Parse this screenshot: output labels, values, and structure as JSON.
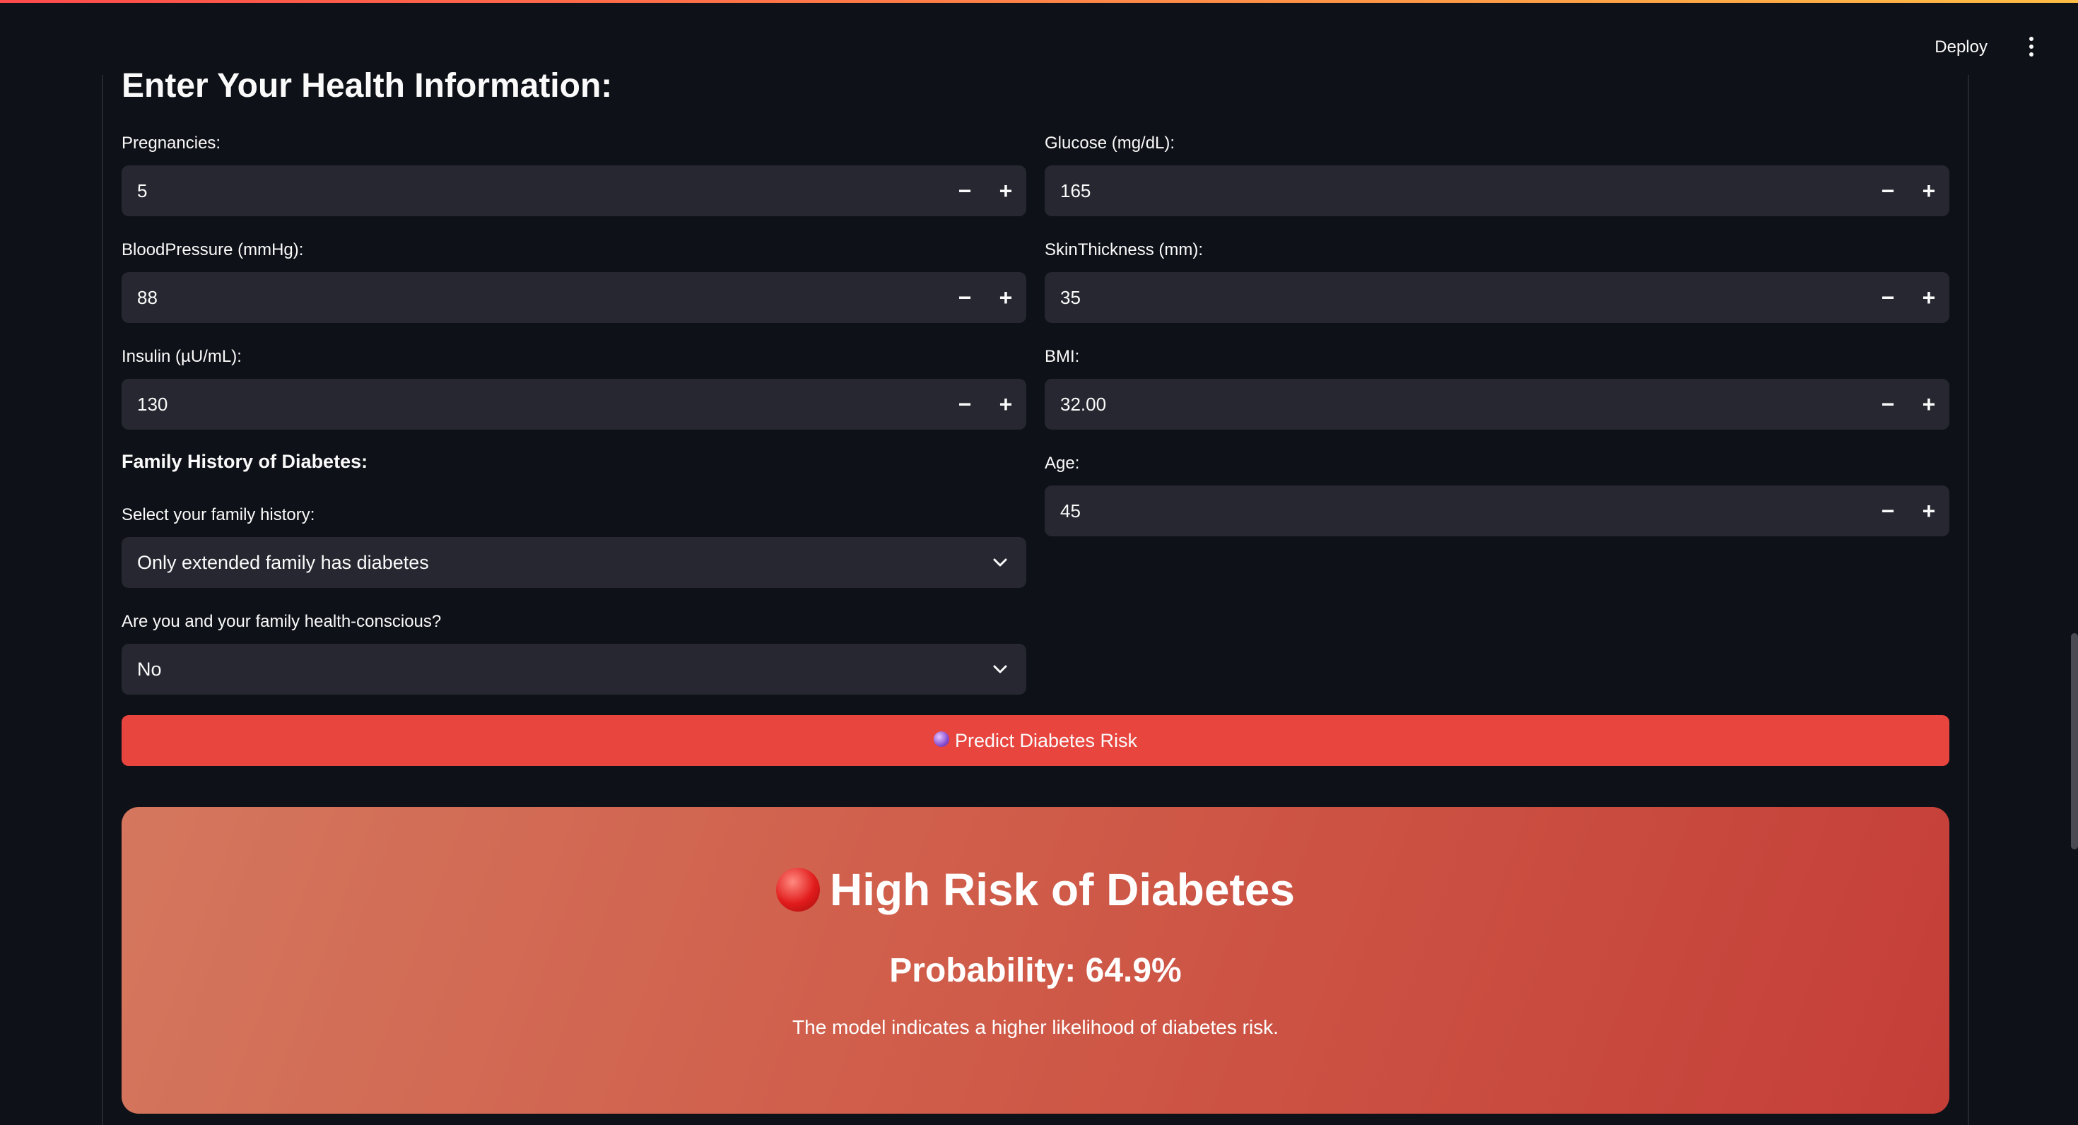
{
  "header": {
    "deploy_label": "Deploy",
    "menu_icon": "vertical-ellipsis-icon"
  },
  "form": {
    "title": "Enter Your Health Information:",
    "pregnancies": {
      "label": "Pregnancies:",
      "value": "5"
    },
    "glucose": {
      "label": "Glucose (mg/dL):",
      "value": "165"
    },
    "blood_pressure": {
      "label": "BloodPressure (mmHg):",
      "value": "88"
    },
    "skin_thickness": {
      "label": "SkinThickness (mm):",
      "value": "35"
    },
    "insulin": {
      "label": "Insulin (µU/mL):",
      "value": "130"
    },
    "bmi": {
      "label": "BMI:",
      "value": "32.00"
    },
    "age": {
      "label": "Age:",
      "value": "45"
    },
    "family_history_heading": "Family History of Diabetes:",
    "family_history": {
      "label": "Select your family history:",
      "value": "Only extended family has diabetes"
    },
    "health_conscious": {
      "label": "Are you and your family health-conscious?",
      "value": "No"
    },
    "stepper_minus": "−",
    "stepper_plus": "+"
  },
  "predict_button": {
    "label": "Predict Diabetes Risk",
    "icon": "crystal-ball-icon"
  },
  "result": {
    "icon": "red-circle-icon",
    "title": "High Risk of Diabetes",
    "probability": "Probability: 64.9%",
    "description": "The model indicates a higher likelihood of diabetes risk."
  },
  "colors": {
    "background": "#0e1117",
    "input_bg": "#262730",
    "primary_button": "#e8453f",
    "result_gradient_start": "#d4775e",
    "result_gradient_end": "#c43e38"
  }
}
